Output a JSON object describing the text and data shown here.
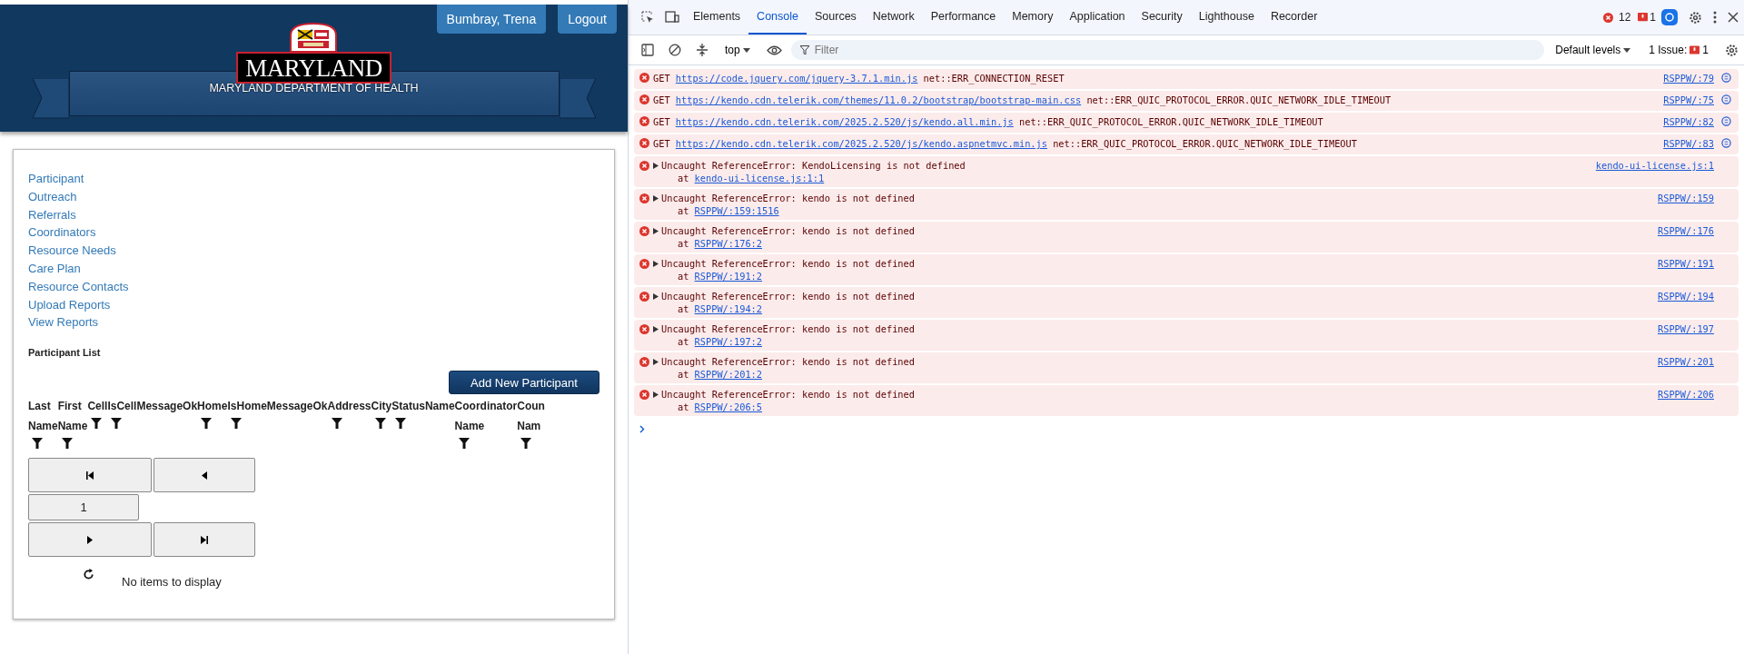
{
  "header": {
    "logo_text": "MARYLAND",
    "department": "MARYLAND DEPARTMENT OF HEALTH",
    "user_button": "Bumbray, Trena",
    "logout_button": "Logout"
  },
  "nav": [
    "Participant",
    "Outreach",
    "Referrals",
    "Coordinators",
    "Resource Needs",
    "Care Plan",
    "Resource Contacts",
    "Upload Reports",
    "View Reports"
  ],
  "participant_list": {
    "title": "Participant List",
    "add_button": "Add New Participant",
    "columns": [
      {
        "label": "Last Name",
        "filter": true
      },
      {
        "label": "First Name",
        "filter": true
      },
      {
        "label": "Cell",
        "filter": true
      },
      {
        "label": "IsCell",
        "filter": true
      },
      {
        "label": "MessageOk",
        "filter": false
      },
      {
        "label": "Home",
        "filter": true
      },
      {
        "label": "IsHome",
        "filter": true
      },
      {
        "label": "MessageOk",
        "filter": false
      },
      {
        "label": "Address",
        "filter": true
      },
      {
        "label": "City",
        "filter": true
      },
      {
        "label": "Status",
        "filter": true
      },
      {
        "label": "Name",
        "filter": false
      },
      {
        "label": "Coordinator Name",
        "filter": true
      },
      {
        "label": "Coun Nam",
        "filter": true
      }
    ],
    "page": "1",
    "empty_message": "No items to display"
  },
  "devtools": {
    "tabs": [
      {
        "label": "Elements",
        "selected": false
      },
      {
        "label": "Console",
        "selected": true
      },
      {
        "label": "Sources",
        "selected": false
      },
      {
        "label": "Network",
        "selected": false
      },
      {
        "label": "Performance",
        "selected": false
      },
      {
        "label": "Memory",
        "selected": false
      },
      {
        "label": "Application",
        "selected": false
      },
      {
        "label": "Security",
        "selected": false
      },
      {
        "label": "Lighthouse",
        "selected": false
      },
      {
        "label": "Recorder",
        "selected": false
      }
    ],
    "error_count": "12",
    "issue_count": "1",
    "context": "top",
    "filter_placeholder": "Filter",
    "levels": "Default levels",
    "issues_label": "1 Issue:",
    "issues_badge": "1",
    "messages": [
      {
        "kind": "network",
        "method": "GET",
        "url": "https://code.jquery.com/jquery-3.7.1.min.js",
        "error": "net::ERR_CONNECTION_RESET",
        "source": "RSPPW/:79"
      },
      {
        "kind": "network",
        "method": "GET",
        "url": "https://kendo.cdn.telerik.com/themes/11.0.2/bootstrap/bootstrap-main.css",
        "error": "net::ERR_QUIC_PROTOCOL_ERROR.QUIC_NETWORK_IDLE_TIMEOUT",
        "source": "RSPPW/:75"
      },
      {
        "kind": "network",
        "method": "GET",
        "url": "https://kendo.cdn.telerik.com/2025.2.520/js/kendo.all.min.js",
        "error": "net::ERR_QUIC_PROTOCOL_ERROR.QUIC_NETWORK_IDLE_TIMEOUT",
        "source": "RSPPW/:82"
      },
      {
        "kind": "network",
        "method": "GET",
        "url": "https://kendo.cdn.telerik.com/2025.2.520/js/kendo.aspnetmvc.min.js",
        "error": "net::ERR_QUIC_PROTOCOL_ERROR.QUIC_NETWORK_IDLE_TIMEOUT",
        "source": "RSPPW/:83"
      },
      {
        "kind": "exception",
        "text": "Uncaught ReferenceError: KendoLicensing is not defined",
        "at": "at",
        "location": "kendo-ui-license.js:1:1",
        "source": "kendo-ui-license.js:1"
      },
      {
        "kind": "exception",
        "text": "Uncaught ReferenceError: kendo is not defined",
        "at": "at",
        "location": "RSPPW/:159:1516",
        "source": "RSPPW/:159"
      },
      {
        "kind": "exception",
        "text": "Uncaught ReferenceError: kendo is not defined",
        "at": "at",
        "location": "RSPPW/:176:2",
        "source": "RSPPW/:176"
      },
      {
        "kind": "exception",
        "text": "Uncaught ReferenceError: kendo is not defined",
        "at": "at",
        "location": "RSPPW/:191:2",
        "source": "RSPPW/:191"
      },
      {
        "kind": "exception",
        "text": "Uncaught ReferenceError: kendo is not defined",
        "at": "at",
        "location": "RSPPW/:194:2",
        "source": "RSPPW/:194"
      },
      {
        "kind": "exception",
        "text": "Uncaught ReferenceError: kendo is not defined",
        "at": "at",
        "location": "RSPPW/:197:2",
        "source": "RSPPW/:197"
      },
      {
        "kind": "exception",
        "text": "Uncaught ReferenceError: kendo is not defined",
        "at": "at",
        "location": "RSPPW/:201:2",
        "source": "RSPPW/:201"
      },
      {
        "kind": "exception",
        "text": "Uncaught ReferenceError: kendo is not defined",
        "at": "at",
        "location": "RSPPW/:206:5",
        "source": "RSPPW/:206"
      }
    ]
  }
}
